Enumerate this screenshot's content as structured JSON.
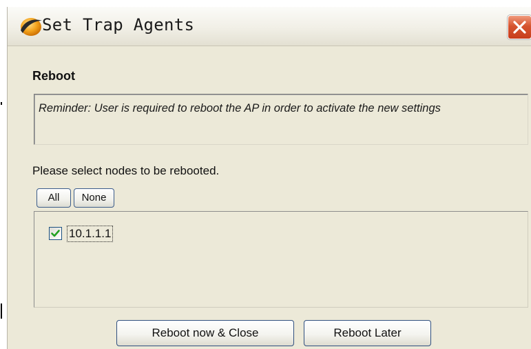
{
  "window": {
    "title": "Set Trap Agents",
    "app_icon": "app-logo-icon",
    "close_icon": "close-icon",
    "accent_color": "#d6542f"
  },
  "reboot_section": {
    "title": "Reboot",
    "reminder": "Reminder: User is required to reboot the AP in order to activate the new settings",
    "instruction": "Please select nodes to be rebooted."
  },
  "selection_buttons": {
    "all_label": "All",
    "none_label": "None"
  },
  "nodes": [
    {
      "label": "10.1.1.1",
      "checked": true
    }
  ],
  "actions": {
    "reboot_now_label": "Reboot now & Close",
    "reboot_later_label": "Reboot Later"
  }
}
